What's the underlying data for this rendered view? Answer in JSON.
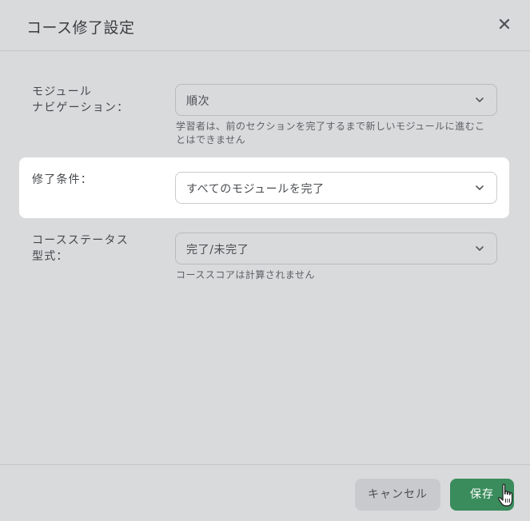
{
  "dialog": {
    "title": "コース修了設定",
    "close_icon": "close-icon"
  },
  "module_navigation": {
    "label_line1": "モジュール",
    "label_line2": "ナビゲーション：",
    "value": "順次",
    "help_line1": "学習者は、前のセクションを完了するまで新しいモジュールに進むこ",
    "help_line2": "とはできません"
  },
  "completion_condition": {
    "label": "修了条件：",
    "value": "すべてのモジュールを完了"
  },
  "course_status_format": {
    "label_line1": "コースステータス",
    "label_line2": "型式：",
    "value": "完了/未完了",
    "help": "コーススコアは計算されません"
  },
  "footer": {
    "cancel_label": "キャンセル",
    "save_label": "保存"
  },
  "colors": {
    "save_button": "#3a8c5c",
    "background": "#d9dadc"
  }
}
